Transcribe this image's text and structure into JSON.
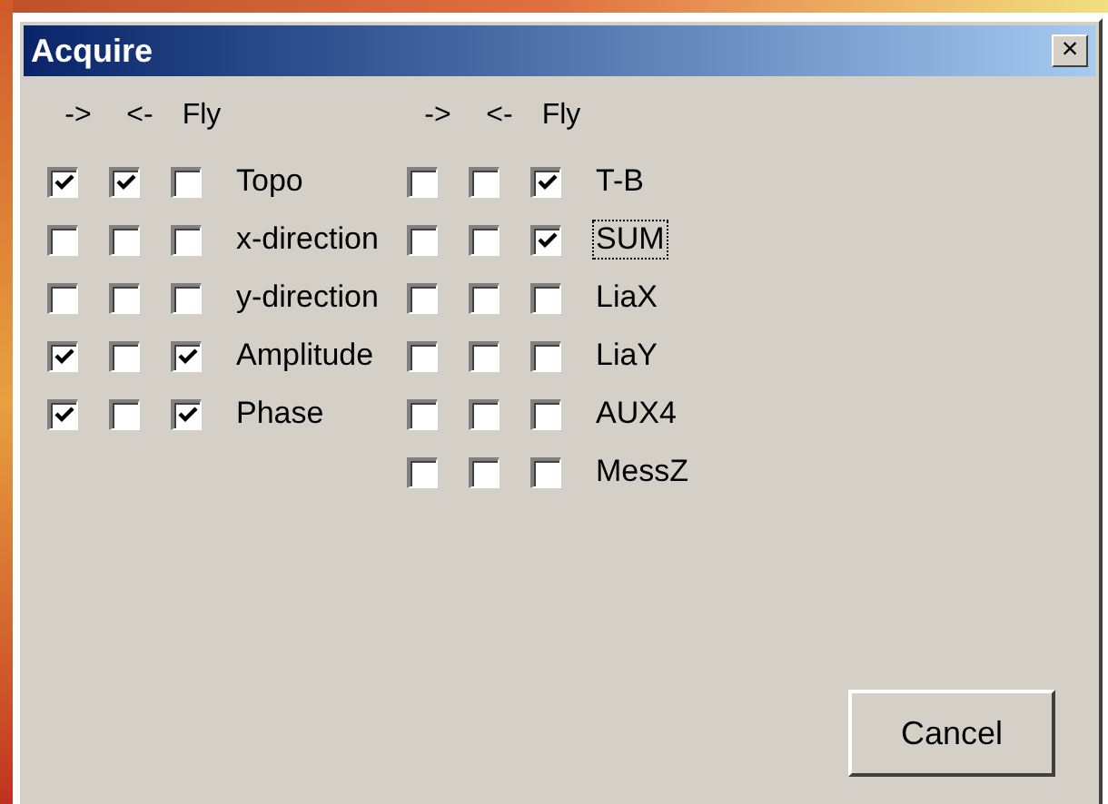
{
  "window": {
    "title": "Acquire",
    "close": "×"
  },
  "groups": [
    {
      "headers": [
        "->",
        "<-",
        "Fly"
      ],
      "rows": [
        {
          "label": "Topo",
          "focused": false,
          "checks": [
            {
              "checked": true
            },
            {
              "checked": true
            },
            {
              "checked": false
            }
          ]
        },
        {
          "label": "x-direction",
          "focused": false,
          "checks": [
            {
              "checked": false
            },
            {
              "checked": false
            },
            {
              "checked": false
            }
          ]
        },
        {
          "label": "y-direction",
          "focused": false,
          "checks": [
            {
              "checked": false
            },
            {
              "checked": false
            },
            {
              "checked": false
            }
          ]
        },
        {
          "label": "Amplitude",
          "focused": false,
          "checks": [
            {
              "checked": true
            },
            {
              "checked": false
            },
            {
              "checked": true
            }
          ]
        },
        {
          "label": "Phase",
          "focused": false,
          "checks": [
            {
              "checked": true
            },
            {
              "checked": false
            },
            {
              "checked": true
            }
          ]
        }
      ]
    },
    {
      "headers": [
        "->",
        "<-",
        "Fly"
      ],
      "rows": [
        {
          "label": "T-B",
          "focused": false,
          "checks": [
            {
              "checked": false
            },
            {
              "checked": false
            },
            {
              "checked": true
            }
          ]
        },
        {
          "label": "SUM",
          "focused": true,
          "checks": [
            {
              "checked": false
            },
            {
              "checked": false
            },
            {
              "checked": true
            }
          ]
        },
        {
          "label": "LiaX",
          "focused": false,
          "checks": [
            {
              "checked": false
            },
            {
              "checked": false
            },
            {
              "checked": false
            }
          ]
        },
        {
          "label": "LiaY",
          "focused": false,
          "checks": [
            {
              "checked": false
            },
            {
              "checked": false
            },
            {
              "checked": false
            }
          ]
        },
        {
          "label": "AUX4",
          "focused": false,
          "checks": [
            {
              "checked": false
            },
            {
              "checked": false
            },
            {
              "checked": false
            }
          ]
        },
        {
          "label": "MessZ",
          "focused": false,
          "checks": [
            {
              "checked": false
            },
            {
              "checked": false
            },
            {
              "checked": false
            }
          ]
        }
      ]
    }
  ],
  "buttons": [
    "Cancel"
  ]
}
